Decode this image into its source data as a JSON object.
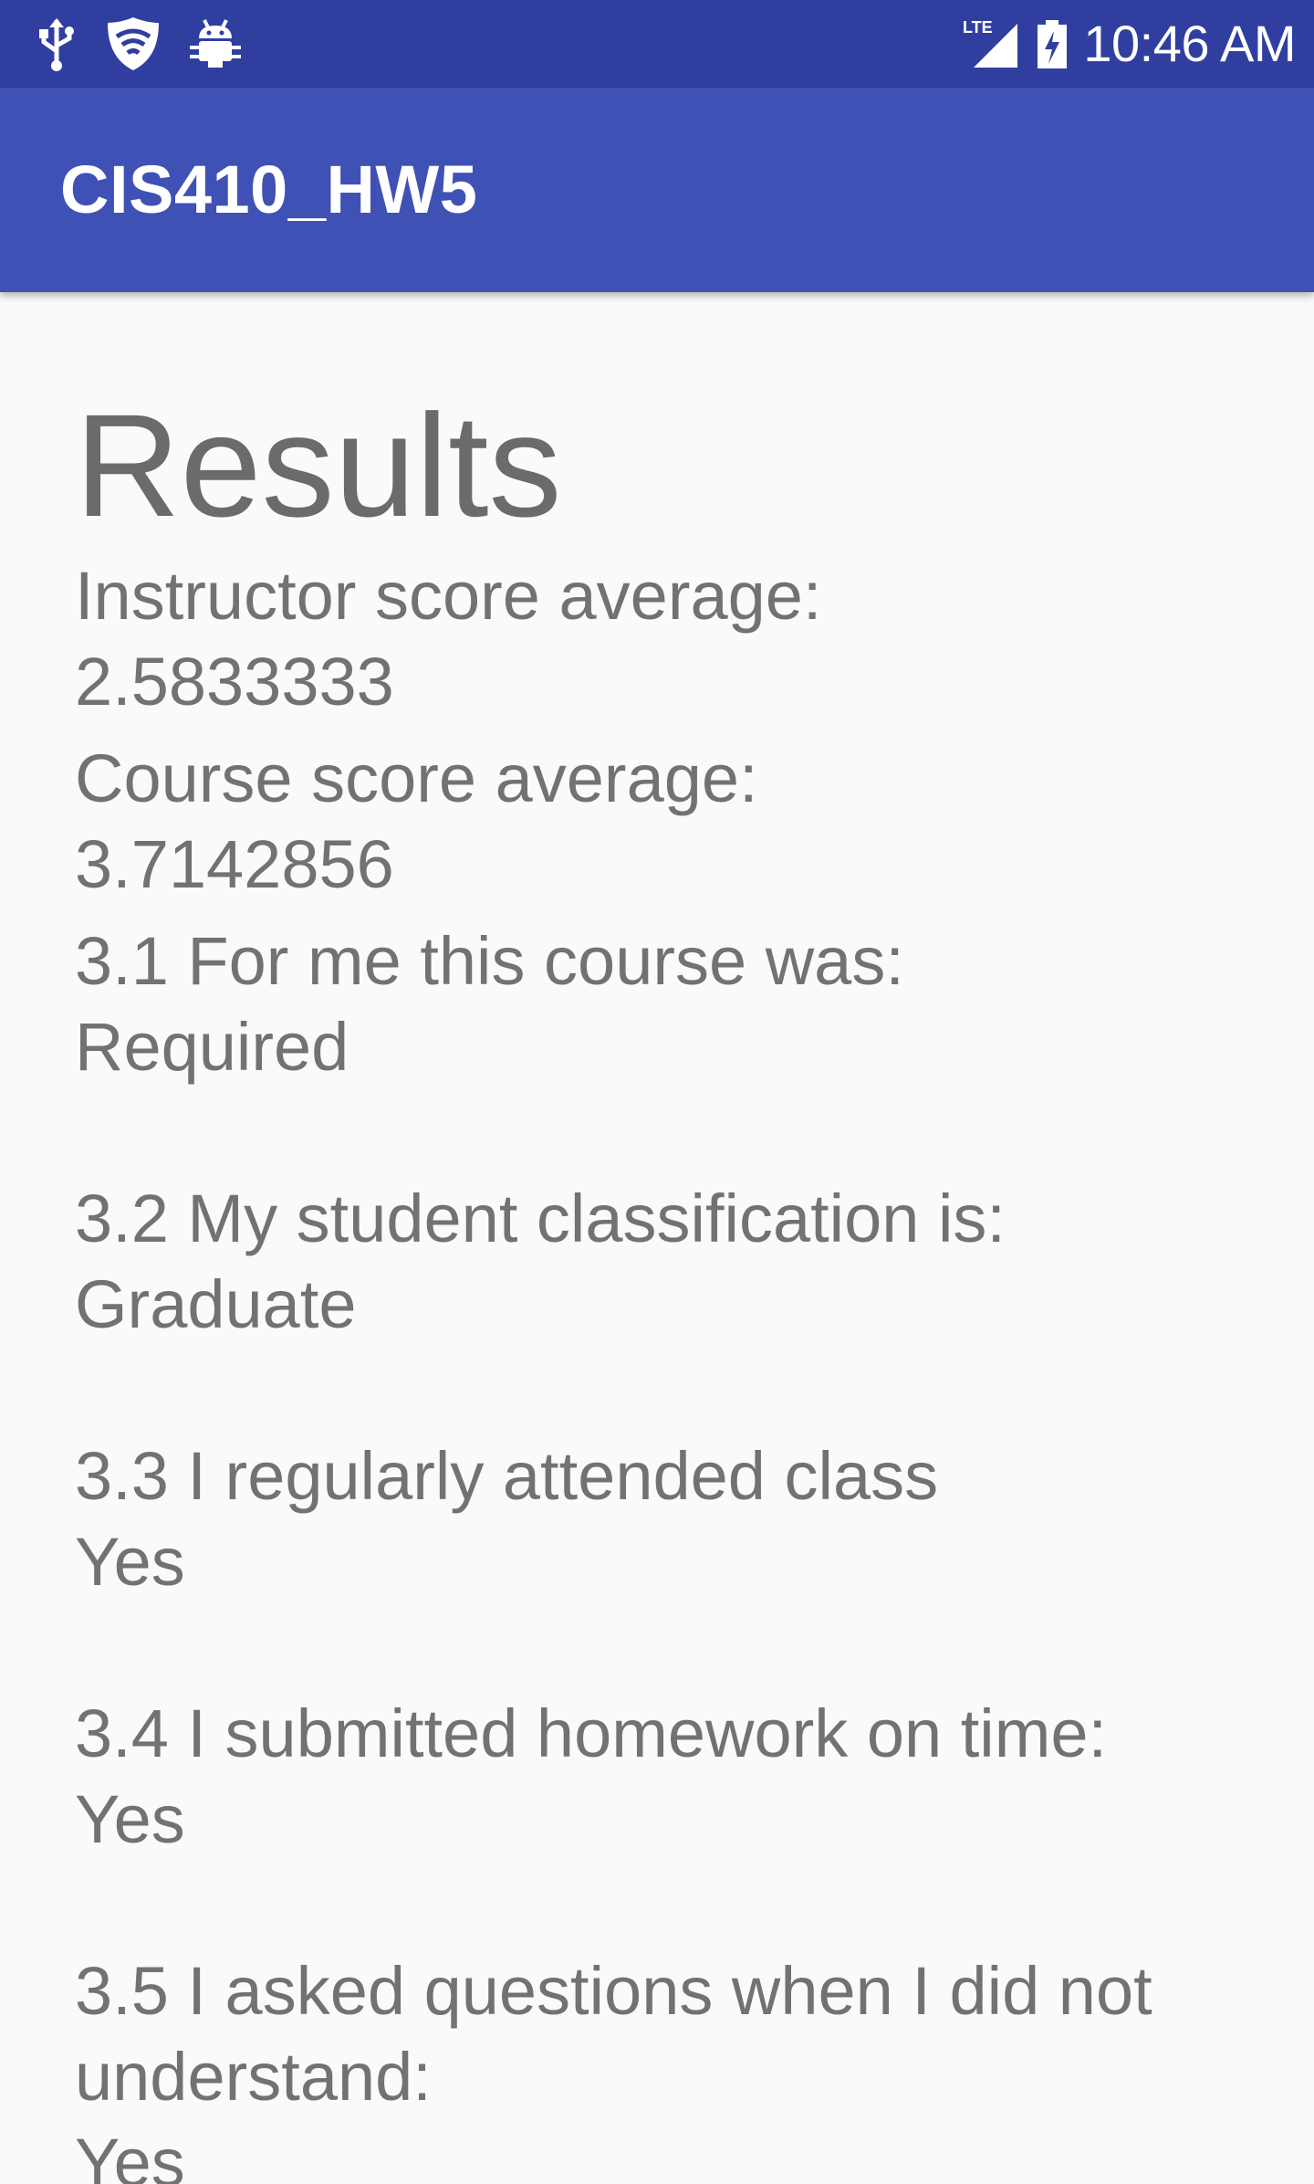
{
  "status_bar": {
    "time": "10:46 AM",
    "network": "LTE",
    "icons_left": [
      "usb-icon",
      "shield-wifi-icon",
      "android-debug-icon"
    ],
    "icons_right": [
      "signal-lte-icon",
      "battery-charging-icon"
    ]
  },
  "app_bar": {
    "title": "CIS410_HW5"
  },
  "results": {
    "heading": "Results",
    "instructor_label": "Instructor score average:",
    "instructor_value": "2.5833333",
    "course_label": "Course score average:",
    "course_value": "3.7142856",
    "questions": [
      {
        "question": "3.1 For me this course was:",
        "answer": "Required"
      },
      {
        "question": "3.2 My student classification is:",
        "answer": "Graduate"
      },
      {
        "question": "3.3 I regularly attended class",
        "answer": "Yes"
      },
      {
        "question": "3.4 I submitted homework on time:",
        "answer": "Yes"
      },
      {
        "question": "3.5 I asked questions when I did not understand:",
        "answer": "Yes"
      }
    ]
  },
  "colors": {
    "status_bar": "#303f9f",
    "app_bar": "#3f51b5",
    "background": "#fafafa",
    "text": "#727272"
  }
}
